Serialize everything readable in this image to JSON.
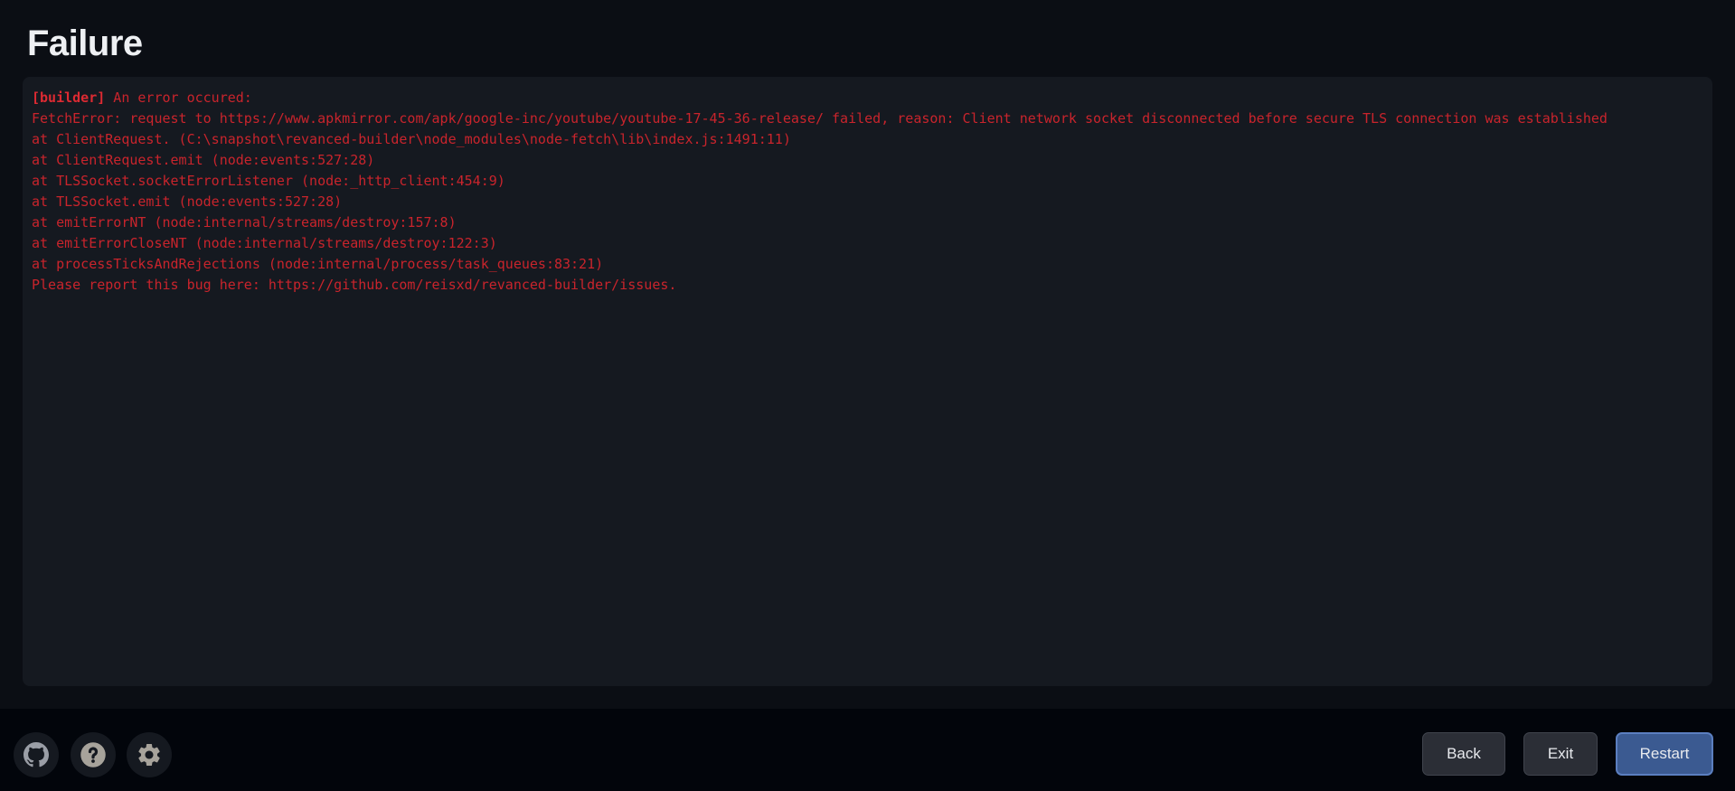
{
  "page": {
    "title": "Failure"
  },
  "log": {
    "tag": "[builder]",
    "first_line_rest": " An error occured:",
    "lines": [
      "FetchError: request to https://www.apkmirror.com/apk/google-inc/youtube/youtube-17-45-36-release/ failed, reason: Client network socket disconnected before secure TLS connection was established",
      "at ClientRequest. (C:\\snapshot\\revanced-builder\\node_modules\\node-fetch\\lib\\index.js:1491:11)",
      "at ClientRequest.emit (node:events:527:28)",
      "at TLSSocket.socketErrorListener (node:_http_client:454:9)",
      "at TLSSocket.emit (node:events:527:28)",
      "at emitErrorNT (node:internal/streams/destroy:157:8)",
      "at emitErrorCloseNT (node:internal/streams/destroy:122:3)",
      "at processTicksAndRejections (node:internal/process/task_queues:83:21)",
      "Please report this bug here: https://github.com/reisxd/revanced-builder/issues."
    ]
  },
  "footer": {
    "icons": [
      {
        "name": "github-icon"
      },
      {
        "name": "help-icon"
      },
      {
        "name": "settings-icon"
      }
    ],
    "buttons": {
      "back_label": "Back",
      "exit_label": "Exit",
      "restart_label": "Restart"
    }
  },
  "colors": {
    "background": "#0b0e14",
    "panel": "#151920",
    "error_text": "#c9242c",
    "primary_button": "#3b5a91"
  }
}
